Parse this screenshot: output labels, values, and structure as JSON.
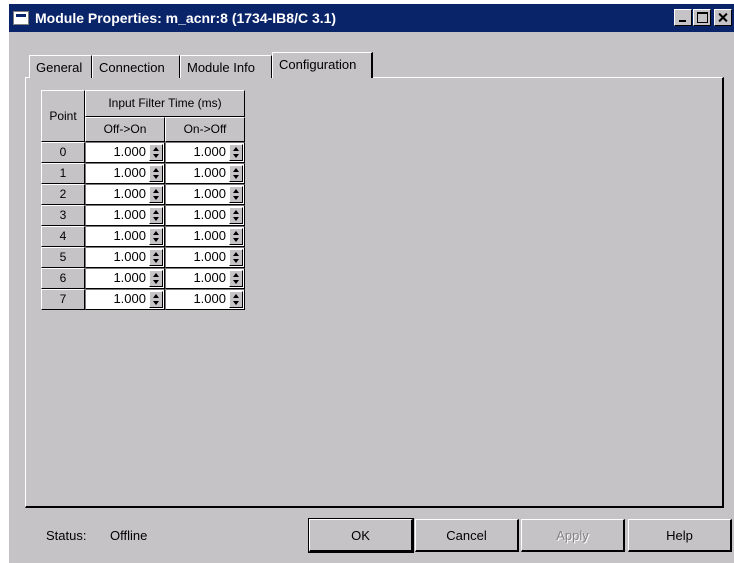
{
  "window": {
    "title": "Module Properties: m_acnr:8 (1734-IB8/C 3.1)"
  },
  "tabs": [
    {
      "label": "General"
    },
    {
      "label": "Connection"
    },
    {
      "label": "Module Info"
    },
    {
      "label": "Configuration",
      "active": true
    }
  ],
  "table": {
    "point_header": "Point",
    "group_header": "Input Filter Time (ms)",
    "col_off_on": "Off->On",
    "col_on_off": "On->Off",
    "rows": [
      {
        "point": "0",
        "off_on": "1.000",
        "on_off": "1.000"
      },
      {
        "point": "1",
        "off_on": "1.000",
        "on_off": "1.000"
      },
      {
        "point": "2",
        "off_on": "1.000",
        "on_off": "1.000"
      },
      {
        "point": "3",
        "off_on": "1.000",
        "on_off": "1.000"
      },
      {
        "point": "4",
        "off_on": "1.000",
        "on_off": "1.000"
      },
      {
        "point": "5",
        "off_on": "1.000",
        "on_off": "1.000"
      },
      {
        "point": "6",
        "off_on": "1.000",
        "on_off": "1.000"
      },
      {
        "point": "7",
        "off_on": "1.000",
        "on_off": "1.000"
      }
    ]
  },
  "footer": {
    "status_label": "Status:",
    "status_value": "Offline",
    "ok": "OK",
    "cancel": "Cancel",
    "apply": "Apply",
    "help": "Help"
  },
  "colors": {
    "titlebar": "#0a246a",
    "face": "#c6c3c6"
  }
}
